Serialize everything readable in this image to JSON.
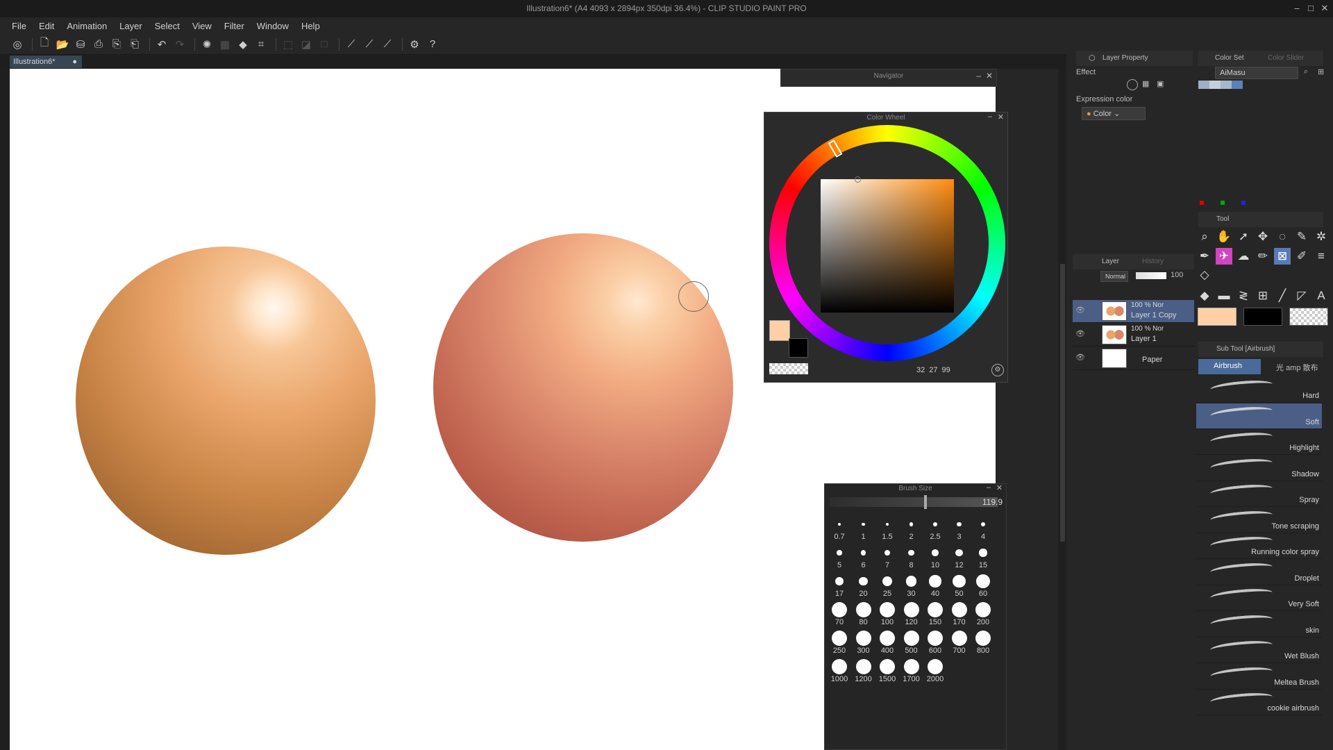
{
  "window": {
    "title": "Illustration6* (A4 4093 x 2894px 350dpi 36.4%) - CLIP STUDIO PAINT PRO"
  },
  "menu": [
    "File",
    "Edit",
    "Animation",
    "Layer",
    "Select",
    "View",
    "Filter",
    "Window",
    "Help"
  ],
  "tab": {
    "label": "Illustration6*",
    "dot": "●"
  },
  "navigator": {
    "title": "Navigator"
  },
  "color_wheel": {
    "title": "Color Wheel",
    "main_color": "#ffd0a6",
    "sub_color": "#000000",
    "h": "32",
    "s": "27",
    "v": "99"
  },
  "brush_size": {
    "title": "Brush Size",
    "value": "119.9",
    "presets": [
      "0.7",
      "1",
      "1.5",
      "2",
      "2.5",
      "3",
      "4",
      "5",
      "6",
      "7",
      "8",
      "10",
      "12",
      "15",
      "17",
      "20",
      "25",
      "30",
      "40",
      "50",
      "60",
      "70",
      "80",
      "100",
      "120",
      "150",
      "170",
      "200",
      "250",
      "300",
      "400",
      "500",
      "600",
      "700",
      "800",
      "1000",
      "1200",
      "1500",
      "1700",
      "2000"
    ]
  },
  "layer_property": {
    "tab": "Layer Property",
    "effect_label": "Effect",
    "expression_color_label": "Expression color",
    "expression_color_value": "Color"
  },
  "color_set": {
    "tab": "Color Set",
    "tab2": "Color Slider",
    "set_name": "AiMasu"
  },
  "layer_panel": {
    "tab": "Layer",
    "tab2": "History",
    "blend_mode": "Normal",
    "opacity": "100",
    "layers": [
      {
        "pct": "100 % Nor",
        "name": "Layer 1 Copy",
        "selected": true
      },
      {
        "pct": "100 % Nor",
        "name": "Layer 1",
        "selected": false
      },
      {
        "pct": "",
        "name": "Paper",
        "selected": false
      }
    ]
  },
  "tool_panel": {
    "tab": "Tool"
  },
  "colors": {
    "main": "#ffd0a6",
    "sub": "#000000"
  },
  "sub_tool": {
    "title": "Sub Tool [Airbrush]",
    "group_airbrush": "Airbrush",
    "group_other": "光 amp 散布",
    "items": [
      "Hard",
      "Soft",
      "Highlight",
      "Shadow",
      "Spray",
      "Tone scraping",
      "Running color spray",
      "Droplet",
      "Very Soft",
      "skin",
      "Wet Blush",
      "Meltea Brush",
      "cookie airbrush"
    ],
    "selected_index": 1
  }
}
